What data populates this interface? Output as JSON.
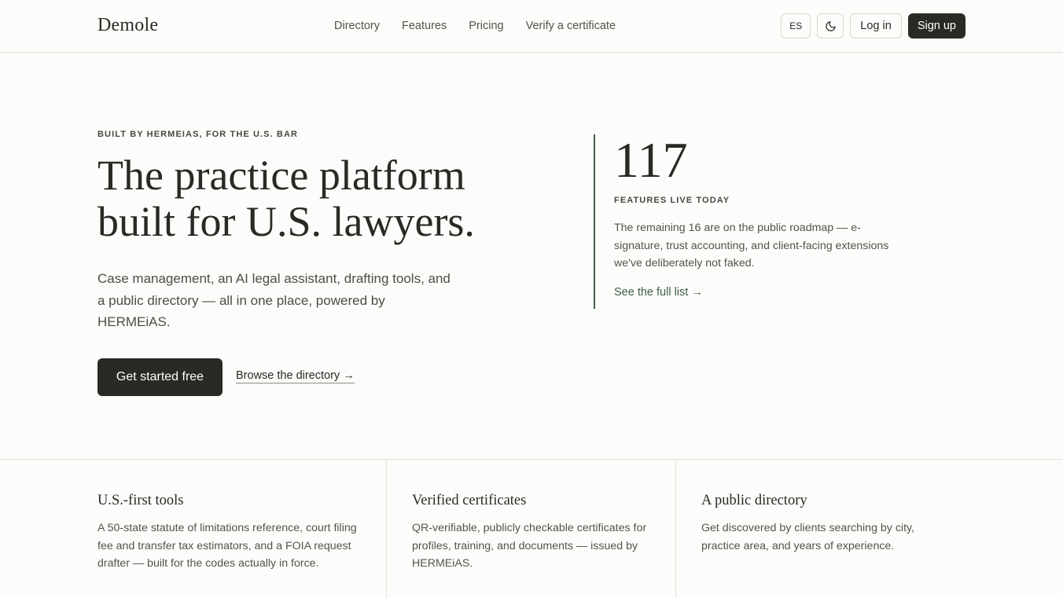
{
  "header": {
    "logo": "Demole",
    "nav": [
      {
        "label": "Directory"
      },
      {
        "label": "Features"
      },
      {
        "label": "Pricing"
      },
      {
        "label": "Verify a certificate"
      }
    ],
    "language_label": "ES",
    "theme_icon": "moon-icon",
    "login_label": "Log in",
    "signup_label": "Sign up"
  },
  "hero": {
    "eyebrow": "BUILT BY HERMEIAS, FOR THE U.S. BAR",
    "title": "The practice platform built for U.S. lawyers.",
    "description": "Case management, an AI legal assistant, drafting tools, and a public directory — all in one place, powered by HERMEiAS.",
    "primary_cta": "Get started free",
    "secondary_cta": "Browse the directory →"
  },
  "stat": {
    "number": "117",
    "label": "FEATURES LIVE TODAY",
    "description": "The remaining 16 are on the public roadmap — e-signature, trust accounting, and client-facing extensions we've deliberately not faked.",
    "link": "See the full list →"
  },
  "features": [
    {
      "title": "U.S.-first tools",
      "description": "A 50-state statute of limitations reference, court filing fee and transfer tax estimators, and a FOIA request drafter — built for the codes actually in force."
    },
    {
      "title": "Verified certificates",
      "description": "QR-verifiable, publicly checkable certificates for profiles, training, and documents — issued by HERMEiAS."
    },
    {
      "title": "A public directory",
      "description": "Get discovered by clients searching by city, practice area, and years of experience."
    }
  ],
  "colors": {
    "background": "#fcfcfa",
    "text": "#2b2925",
    "accent_green": "#3f5e49",
    "border": "#e4e2dd"
  }
}
